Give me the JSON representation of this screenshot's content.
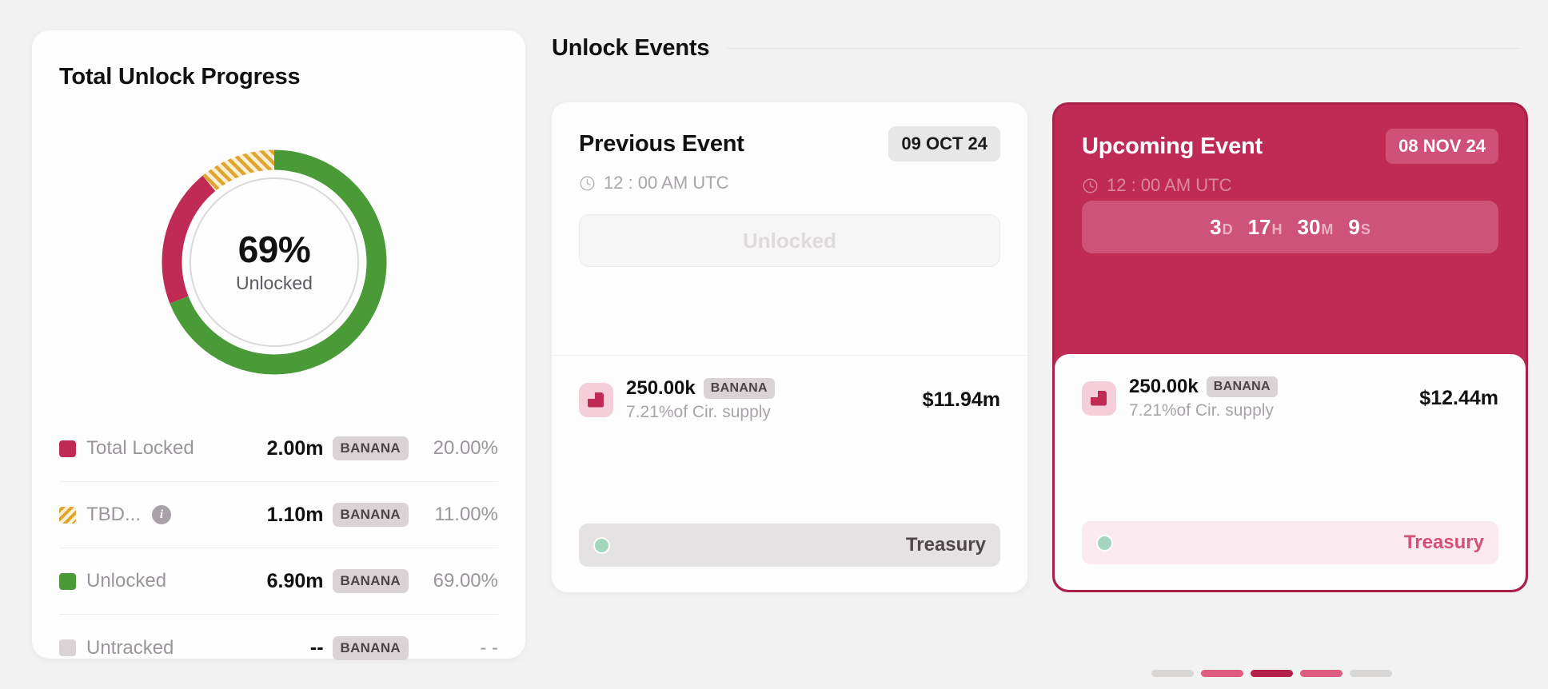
{
  "progress_card": {
    "title": "Total Unlock Progress",
    "donut": {
      "center_value": "69%",
      "center_label": "Unlocked",
      "colors": {
        "locked": "#bf2b55",
        "tbd": "#e0a52e",
        "unlocked": "#4a9b38",
        "untracked": "#d9d3d6",
        "inner_ring": "#dcd7d9"
      }
    },
    "legend": [
      {
        "label": "Total Locked",
        "value": "2.00m",
        "token": "BANANA",
        "percent": "20.00%",
        "swatch": "#bf2b55",
        "striped": false,
        "has_info": false
      },
      {
        "label": "TBD...",
        "value": "1.10m",
        "token": "BANANA",
        "percent": "11.00%",
        "swatch": "#e0a52e",
        "striped": true,
        "has_info": true
      },
      {
        "label": "Unlocked",
        "value": "6.90m",
        "token": "BANANA",
        "percent": "69.00%",
        "swatch": "#4a9b38",
        "striped": false,
        "has_info": false
      },
      {
        "label": "Untracked",
        "value": "--",
        "token": "BANANA",
        "percent": "- -",
        "swatch": "#d9d3d6",
        "striped": false,
        "has_info": false
      }
    ]
  },
  "events": {
    "section_title": "Unlock Events",
    "previous": {
      "name": "Previous Event",
      "date": "09 OCT 24",
      "time": "12 : 00 AM UTC",
      "status": "Unlocked",
      "allocation": {
        "amount": "250.00k",
        "token": "BANANA",
        "supply_note": "7.21%of Cir. supply",
        "usd_value": "$11.94m"
      },
      "tag": "Treasury"
    },
    "upcoming": {
      "name": "Upcoming Event",
      "date": "08 NOV 24",
      "time": "12 : 00 AM UTC",
      "countdown": {
        "days": "3",
        "days_unit": "D",
        "hours": "17",
        "hours_unit": "H",
        "minutes": "30",
        "minutes_unit": "M",
        "seconds": "9",
        "seconds_unit": "S"
      },
      "allocation": {
        "amount": "250.00k",
        "token": "BANANA",
        "supply_note": "7.21%of Cir. supply",
        "usd_value": "$12.44m"
      },
      "tag": "Treasury"
    },
    "pagination": [
      {
        "color": "#d9d6d6"
      },
      {
        "color": "#de5c7f"
      },
      {
        "color": "#b4214b"
      },
      {
        "color": "#de5c7f"
      },
      {
        "color": "#d9d6d6"
      }
    ]
  },
  "chart_data": {
    "type": "pie",
    "title": "Total Unlock Progress",
    "categories": [
      "Unlocked",
      "Total Locked",
      "TBD...",
      "Untracked"
    ],
    "values": [
      69.0,
      20.0,
      11.0,
      0
    ],
    "value_labels": [
      "6.90m",
      "2.00m",
      "1.10m",
      "--"
    ],
    "percent_labels": [
      "69.00%",
      "20.00%",
      "11.00%",
      "- -"
    ],
    "colors": [
      "#4a9b38",
      "#bf2b55",
      "#e0a52e",
      "#d9d3d6"
    ],
    "unit": "BANANA",
    "center_text": "69%",
    "center_subtext": "Unlocked",
    "legend": "bottom",
    "donut": true
  }
}
